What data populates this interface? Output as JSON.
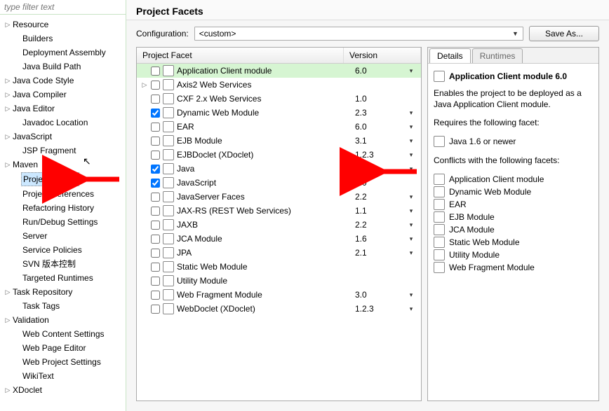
{
  "filter_placeholder": "type filter text",
  "sidebar": {
    "items": [
      {
        "label": "Resource",
        "exp": true
      },
      {
        "label": "Builders",
        "exp": false,
        "child": true
      },
      {
        "label": "Deployment Assembly",
        "exp": false,
        "child": true
      },
      {
        "label": "Java Build Path",
        "exp": false,
        "child": true
      },
      {
        "label": "Java Code Style",
        "exp": true
      },
      {
        "label": "Java Compiler",
        "exp": true
      },
      {
        "label": "Java Editor",
        "exp": true
      },
      {
        "label": "Javadoc Location",
        "exp": false,
        "child": true
      },
      {
        "label": "JavaScript",
        "exp": true
      },
      {
        "label": "JSP Fragment",
        "exp": false,
        "child": true
      },
      {
        "label": "Maven",
        "exp": true
      },
      {
        "label": "Project Facets",
        "exp": false,
        "child": true,
        "selected": true
      },
      {
        "label": "Project References",
        "exp": false,
        "child": true
      },
      {
        "label": "Refactoring History",
        "exp": false,
        "child": true
      },
      {
        "label": "Run/Debug Settings",
        "exp": false,
        "child": true
      },
      {
        "label": "Server",
        "exp": false,
        "child": true
      },
      {
        "label": "Service Policies",
        "exp": false,
        "child": true
      },
      {
        "label": "SVN 版本控制",
        "exp": false,
        "child": true
      },
      {
        "label": "Targeted Runtimes",
        "exp": false,
        "child": true
      },
      {
        "label": "Task Repository",
        "exp": true
      },
      {
        "label": "Task Tags",
        "exp": false,
        "child": true
      },
      {
        "label": "Validation",
        "exp": true
      },
      {
        "label": "Web Content Settings",
        "exp": false,
        "child": true
      },
      {
        "label": "Web Page Editor",
        "exp": false,
        "child": true
      },
      {
        "label": "Web Project Settings",
        "exp": false,
        "child": true
      },
      {
        "label": "WikiText",
        "exp": false,
        "child": true
      },
      {
        "label": "XDoclet",
        "exp": true
      }
    ]
  },
  "header_title": "Project Facets",
  "config_label": "Configuration:",
  "config_value": "<custom>",
  "save_as_label": "Save As...",
  "cols": {
    "facet": "Project Facet",
    "version": "Version"
  },
  "facets": [
    {
      "name": "Application Client module",
      "ver": "6.0",
      "checked": false,
      "drop": true,
      "highlight": true
    },
    {
      "name": "Axis2 Web Services",
      "ver": "",
      "checked": false,
      "exp": true
    },
    {
      "name": "CXF 2.x Web Services",
      "ver": "1.0",
      "checked": false
    },
    {
      "name": "Dynamic Web Module",
      "ver": "2.3",
      "checked": true,
      "drop": true
    },
    {
      "name": "EAR",
      "ver": "6.0",
      "checked": false,
      "drop": true
    },
    {
      "name": "EJB Module",
      "ver": "3.1",
      "checked": false,
      "drop": true
    },
    {
      "name": "EJBDoclet (XDoclet)",
      "ver": "1.2.3",
      "checked": false,
      "drop": true
    },
    {
      "name": "Java",
      "ver": "1.7",
      "checked": true,
      "drop": true
    },
    {
      "name": "JavaScript",
      "ver": "1.0",
      "checked": true
    },
    {
      "name": "JavaServer Faces",
      "ver": "2.2",
      "checked": false,
      "drop": true
    },
    {
      "name": "JAX-RS (REST Web Services)",
      "ver": "1.1",
      "checked": false,
      "drop": true
    },
    {
      "name": "JAXB",
      "ver": "2.2",
      "checked": false,
      "drop": true
    },
    {
      "name": "JCA Module",
      "ver": "1.6",
      "checked": false,
      "drop": true
    },
    {
      "name": "JPA",
      "ver": "2.1",
      "checked": false,
      "drop": true
    },
    {
      "name": "Static Web Module",
      "ver": "",
      "checked": false
    },
    {
      "name": "Utility Module",
      "ver": "",
      "checked": false
    },
    {
      "name": "Web Fragment Module",
      "ver": "3.0",
      "checked": false,
      "drop": true
    },
    {
      "name": "WebDoclet (XDoclet)",
      "ver": "1.2.3",
      "checked": false,
      "drop": true
    }
  ],
  "tabs": {
    "details": "Details",
    "runtimes": "Runtimes"
  },
  "detail": {
    "title": "Application Client module 6.0",
    "desc": "Enables the project to be deployed as a Java Application Client module.",
    "requires_label": "Requires the following facet:",
    "requires": [
      "Java 1.6 or newer"
    ],
    "conflicts_label": "Conflicts with the following facets:",
    "conflicts": [
      "Application Client module",
      "Dynamic Web Module",
      "EAR",
      "EJB Module",
      "JCA Module",
      "Static Web Module",
      "Utility Module",
      "Web Fragment Module"
    ]
  }
}
